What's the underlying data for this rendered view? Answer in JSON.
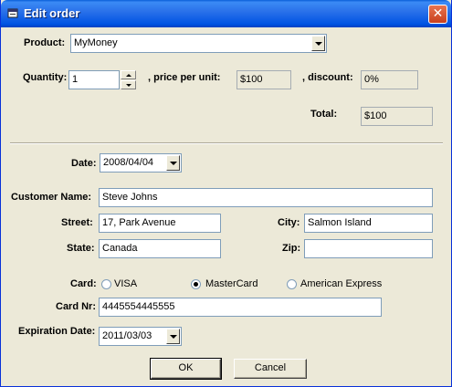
{
  "window": {
    "title": "Edit order"
  },
  "product": {
    "label": "Product:",
    "value": "MyMoney"
  },
  "quantity": {
    "label": "Quantity:",
    "value": "1"
  },
  "price": {
    "label": ", price per unit:",
    "value": "$100"
  },
  "discount": {
    "label": ", discount:",
    "value": "0%"
  },
  "total": {
    "label": "Total:",
    "value": "$100"
  },
  "date": {
    "label": "Date:",
    "value": "2008/04/04"
  },
  "customer": {
    "name_label": "Customer Name:",
    "name": "Steve Johns",
    "street_label": "Street:",
    "street": "17, Park Avenue",
    "city_label": "City:",
    "city": "Salmon Island",
    "state_label": "State:",
    "state": "Canada",
    "zip_label": "Zip:",
    "zip": ""
  },
  "card": {
    "label": "Card:",
    "options": [
      "VISA",
      "MasterCard",
      "American Express"
    ],
    "selected": "MasterCard",
    "nr_label": "Card Nr:",
    "nr": "4445554445555",
    "exp_label": "Expiration Date:",
    "exp": "2011/03/03"
  },
  "buttons": {
    "ok": "OK",
    "cancel": "Cancel"
  },
  "colors": {
    "dialog_bg": "#ece9d8",
    "titlebar": "#0054e3",
    "close": "#c8401e"
  }
}
